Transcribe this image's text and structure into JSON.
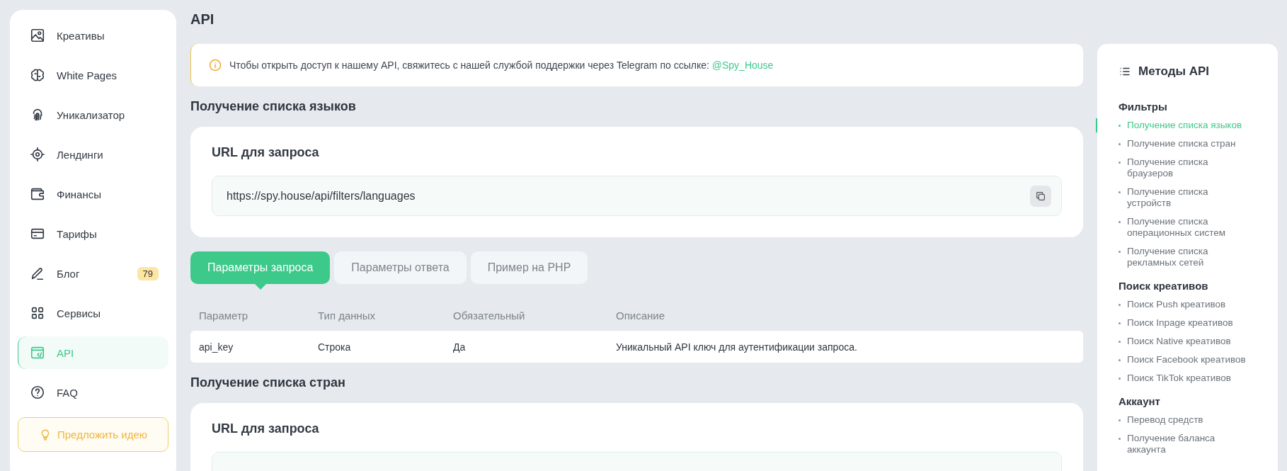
{
  "sidebar": {
    "items": [
      {
        "label": "Креативы",
        "selected": false
      },
      {
        "label": "White Pages",
        "selected": false
      },
      {
        "label": "Уникализатор",
        "selected": false
      },
      {
        "label": "Лендинги",
        "selected": false
      },
      {
        "label": "Финансы",
        "selected": false
      },
      {
        "label": "Тарифы",
        "selected": false
      },
      {
        "label": "Блог",
        "selected": false,
        "badge": "79"
      },
      {
        "label": "Сервисы",
        "selected": false
      },
      {
        "label": "API",
        "selected": true
      },
      {
        "label": "FAQ",
        "selected": false
      }
    ],
    "suggest_button": "Предложить идею"
  },
  "page_title": "API",
  "notice": {
    "text": "Чтобы открыть доступ к нашему API, свяжитесь с нашей службой поддержки через Telegram по ссылке:",
    "link": "@Spy_House"
  },
  "sections": [
    {
      "title": "Получение списка языков",
      "url_label": "URL для запроса",
      "url": "https://spy.house/api/filters/languages",
      "tabs": [
        {
          "label": "Параметры запроса",
          "selected": true
        },
        {
          "label": "Параметры ответа",
          "selected": false
        },
        {
          "label": "Пример на PHP",
          "selected": false
        }
      ],
      "table": {
        "columns": [
          "Параметр",
          "Тип данных",
          "Обязательный",
          "Описание"
        ],
        "rows": [
          [
            "api_key",
            "Строка",
            "Да",
            "Уникальный API ключ для аутентификации запроса."
          ]
        ]
      }
    },
    {
      "title": "Получение списка стран",
      "url_label": "URL для запроса"
    }
  ],
  "methods": {
    "title": "Методы API",
    "groups": [
      {
        "title": "Фильтры",
        "items": [
          {
            "label": "Получение списка языков",
            "selected": true
          },
          {
            "label": "Получение списка стран",
            "selected": false
          },
          {
            "label": "Получение списка браузеров",
            "selected": false
          },
          {
            "label": "Получение списка устройств",
            "selected": false
          },
          {
            "label": "Получение списка операционных систем",
            "selected": false
          },
          {
            "label": "Получение списка рекламных сетей",
            "selected": false
          }
        ]
      },
      {
        "title": "Поиск креативов",
        "items": [
          {
            "label": "Поиск Push креативов",
            "selected": false
          },
          {
            "label": "Поиск Inpage креативов",
            "selected": false
          },
          {
            "label": "Поиск Native креативов",
            "selected": false
          },
          {
            "label": "Поиск Facebook креативов",
            "selected": false
          },
          {
            "label": "Поиск TikTok креативов",
            "selected": false
          }
        ]
      },
      {
        "title": "Аккаунт",
        "items": [
          {
            "label": "Перевод средств",
            "selected": false
          },
          {
            "label": "Получение баланса аккаунта",
            "selected": false
          }
        ]
      }
    ]
  }
}
